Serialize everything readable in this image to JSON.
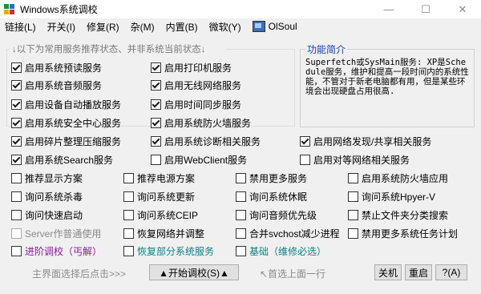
{
  "window": {
    "title": "Windows系统调校",
    "min": "—",
    "max": "☐",
    "close": "✕"
  },
  "menu": [
    "链接(L)",
    "开关(I)",
    "修复(R)",
    "杂(M)",
    "内置(B)",
    "微软(Y)"
  ],
  "menu_olsoul": "OlSoul",
  "group_legend": "↓以下为常用服务推荐状态、并非系统当前状态↓",
  "info": {
    "title": "功能简介",
    "text": "Superfetch或SysMain服务: XP是Schedule服务，维护和提高一段时间内的系统性能，不管对于新老电脑都有用，但是某些环境会出现硬盘占用很高."
  },
  "checkboxes": {
    "c1": [
      "启用系统预读服务",
      "启用系统音频服务",
      "启用设备自动播放服务",
      "启用系统安全中心服务",
      "启用碎片整理压缩服务",
      "启用系统Search服务"
    ],
    "c2": [
      "启用打印机服务",
      "启用无线网络服务",
      "启用时间同步服务",
      "启用系统防火墙服务",
      "启用系统诊断相关服务",
      "启用WebClient服务"
    ],
    "c3": [
      "启用网络发现/共享相关服务",
      "启用对等网络相关服务"
    ],
    "grid1": [
      "推荐显示方案",
      "询问系统杀毒",
      "询问快速启动",
      "Server作普通使用",
      "进阶调校（丐解）"
    ],
    "grid2": [
      "推荐电源方案",
      "询问系统更新",
      "询问系统CEIP",
      "恢复网络并调整",
      "恢复部分系统服务"
    ],
    "grid3": [
      "禁用更多服务",
      "询问系统休眠",
      "询问音频优先级",
      "合并svchost减少进程",
      "基础（维修必选）"
    ],
    "grid4": [
      "启用系统防火墙应用",
      "询问系统Hpyer-V",
      "禁止文件夹分类搜索",
      "禁用更多系统任务计划"
    ]
  },
  "footer": {
    "hint1": "主界面选择后点击>>>",
    "start": "▲开始调校(S)▲",
    "hint2": "↖首选上面一行",
    "shutdown": "关机",
    "restart": "重启",
    "about": "?(A)"
  },
  "colors": {
    "purple": "#8a1aa8",
    "teal": "#0e7f86",
    "info_title": "#1a3fb0"
  }
}
